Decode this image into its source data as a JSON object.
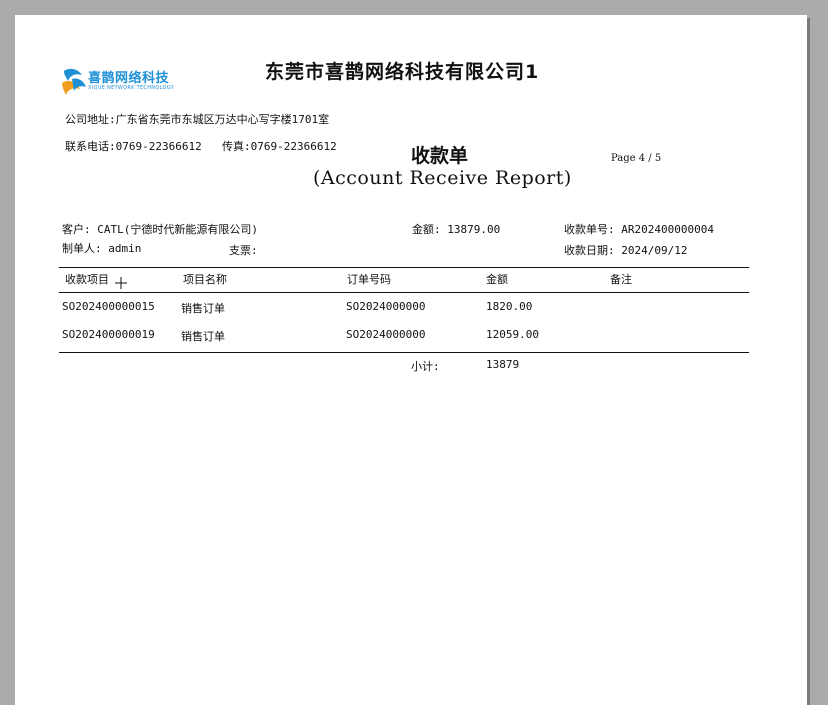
{
  "company": {
    "name": "东莞市喜鹊网络科技有限公司1",
    "logo_text": "喜鹊网络科技",
    "logo_sub": "XIQUE NETWORK TECHNOLOGY",
    "address": "公司地址:广东省东莞市东城区万达中心写字楼1701室",
    "phone": "联系电话:0769-22366612",
    "fax": "传真:0769-22366612"
  },
  "report": {
    "title_cn": "收款单",
    "title_en": "(Account Receive Report)",
    "page": "Page 4 / 5"
  },
  "info": {
    "customer": "客户: CATL(宁德时代新能源有限公司)",
    "amount": "金额: 13879.00",
    "receipt_no": "收款单号: AR202400000004",
    "maker": "制单人: admin",
    "check": "支票:",
    "receipt_date": "收款日期: 2024/09/12"
  },
  "table": {
    "headers": [
      "收款项目",
      "项目名称",
      "订单号码",
      "金额",
      "备注"
    ],
    "rows": [
      [
        "SO202400000015",
        "销售订单",
        "SO2024000000",
        "1820.00",
        ""
      ],
      [
        "SO202400000019",
        "销售订单",
        "SO2024000000",
        "12059.00",
        ""
      ]
    ],
    "subtotal_label": "小计:",
    "subtotal_value": "13879"
  },
  "colors": {
    "background": "#ababab",
    "paper": "#ffffff",
    "logo": "#1e90d6"
  }
}
